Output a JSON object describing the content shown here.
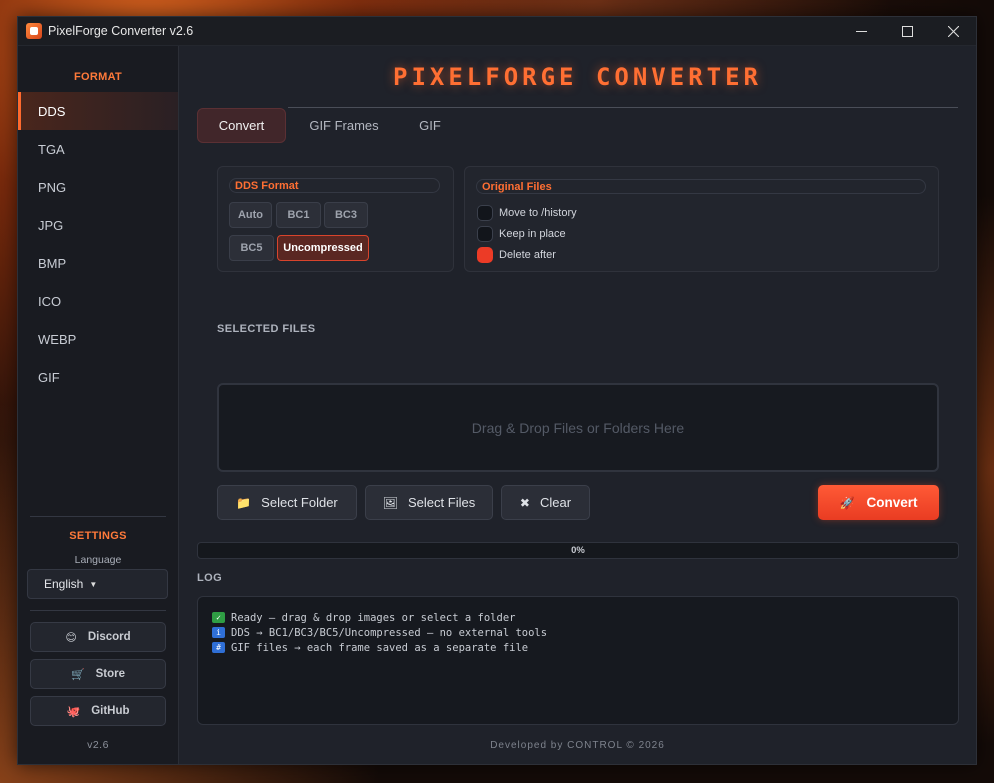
{
  "window": {
    "title": "PixelForge Converter  v2.6",
    "controls": {
      "minimize": "minimize-icon",
      "maximize": "maximize-icon",
      "close": "close-icon"
    }
  },
  "sidebar": {
    "format_heading": "FORMAT",
    "items": [
      {
        "label": "DDS",
        "active": true
      },
      {
        "label": "TGA"
      },
      {
        "label": "PNG"
      },
      {
        "label": "JPG"
      },
      {
        "label": "BMP"
      },
      {
        "label": "ICO"
      },
      {
        "label": "WEBP"
      },
      {
        "label": "GIF"
      }
    ],
    "settings_heading": "SETTINGS",
    "language_label": "Language",
    "language_value": "English",
    "links": [
      {
        "label": "Discord",
        "icon": "discord-icon"
      },
      {
        "label": "Store",
        "icon": "store-icon"
      },
      {
        "label": "GitHub",
        "icon": "github-icon"
      }
    ],
    "version": "v2.6"
  },
  "main": {
    "title": "PIXELFORGE CONVERTER",
    "tabs": [
      {
        "label": "Convert",
        "active": true
      },
      {
        "label": "GIF Frames"
      },
      {
        "label": "GIF"
      }
    ],
    "dds_format": {
      "title": "DDS Format",
      "options": [
        "Auto",
        "BC1",
        "BC3",
        "BC5",
        "Uncompressed"
      ],
      "selected": "Uncompressed"
    },
    "original_files": {
      "title": "Original Files",
      "options": [
        "Move to /history",
        "Keep in place",
        "Delete after"
      ],
      "selected": "Delete after"
    },
    "selected_files_label": "SELECTED FILES",
    "dropzone_text": "Drag & Drop Files or Folders Here",
    "buttons": {
      "select_folder": "Select Folder",
      "select_files": "Select Files",
      "clear": "Clear",
      "convert": "Convert"
    },
    "progress": {
      "value": 0,
      "text": "0%"
    },
    "log_label": "LOG",
    "log_lines": [
      {
        "icon": "check-icon",
        "text": "Ready — drag & drop images or select a folder"
      },
      {
        "icon": "info-icon",
        "text": "DDS → BC1/BC3/BC5/Uncompressed — no external tools"
      },
      {
        "icon": "numbers-icon",
        "text": "GIF files → each frame saved as a separate file"
      }
    ],
    "footer": "Developed by CONTROL © 2026"
  },
  "colors": {
    "accent": "#ff6f33",
    "convert_button": "#ec3b26",
    "background": "#1f222a"
  }
}
